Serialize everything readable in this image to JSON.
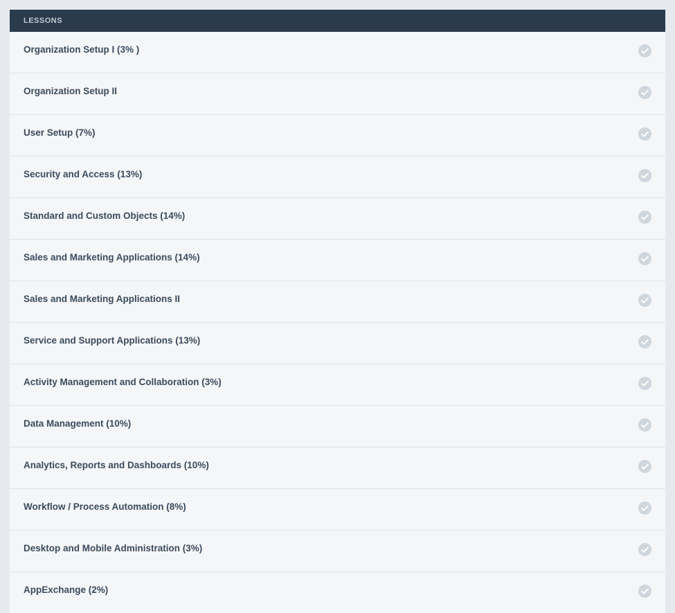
{
  "header": {
    "title": "LESSONS"
  },
  "lessons": [
    {
      "title": "Organization Setup I (3% )"
    },
    {
      "title": "Organization Setup II"
    },
    {
      "title": "User Setup (7%)"
    },
    {
      "title": "Security and Access (13%)"
    },
    {
      "title": "Standard and Custom Objects (14%)"
    },
    {
      "title": "Sales and Marketing Applications (14%)"
    },
    {
      "title": "Sales and Marketing Applications II"
    },
    {
      "title": "Service and Support Applications (13%)"
    },
    {
      "title": "Activity Management and Collaboration (3%)"
    },
    {
      "title": "Data Management (10%)"
    },
    {
      "title": "Analytics, Reports and Dashboards (10%)"
    },
    {
      "title": "Workflow / Process Automation (8%)"
    },
    {
      "title": "Desktop and Mobile Administration (3%)"
    },
    {
      "title": "AppExchange (2%)"
    }
  ],
  "colors": {
    "header_bg": "#2b3b4d",
    "page_bg": "#e6eaef",
    "row_bg": "#f4f6f8",
    "text": "#3b4a5c",
    "check_fill": "#cfd6dd"
  }
}
